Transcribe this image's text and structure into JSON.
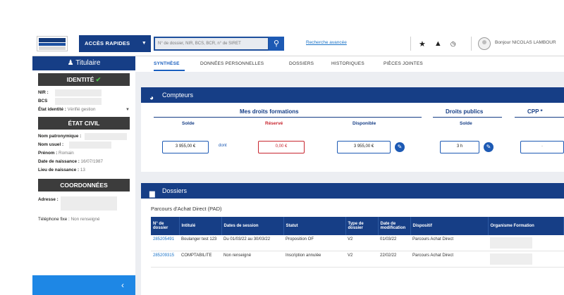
{
  "topbar": {
    "quick_access_label": "ACCÈS RAPIDES",
    "search_placeholder": "N° de dossier, NIR, BCS, BCR, n° de SIRET",
    "advanced_search_label": "Recherche avancée",
    "user_greeting": "Bonjour NICOLAS LAMBOUR",
    "icons": [
      "search-icon",
      "star-icon",
      "warning-icon",
      "clock-icon",
      "avatar-icon"
    ]
  },
  "sidebar": {
    "titulaire_label": "Titulaire",
    "identite": {
      "title": "IDENTITÉ",
      "nir_label": "NIR :",
      "bcs_label": "BCS",
      "etat_label": "État identité :",
      "etat_value": "Vérifié gestion"
    },
    "etat_civil": {
      "title": "ÉTAT CIVIL",
      "nom_patronymique": "Nom patronymique :",
      "nom_usuel": "Nom usuel :",
      "prenom_label": "Prénom :",
      "prenom_value": "Romain",
      "naissance_label": "Date de naissance :",
      "naissance_value": "16/07/1987",
      "lieu_label": "Lieu de naissance :",
      "lieu_value": "13"
    },
    "coordonnees": {
      "title": "COORDONNÉES",
      "adresse_label": "Adresse :",
      "tel_label": "Téléphone fixe :",
      "tel_value": "Non renseigné"
    },
    "collapse_label": "‹"
  },
  "tabs": [
    {
      "label": "SYNTHÈSE",
      "active": true
    },
    {
      "label": "DONNÉES PERSONNELLES",
      "active": false
    },
    {
      "label": "DOSSIERS",
      "active": false
    },
    {
      "label": "HISTORIQUES",
      "active": false
    },
    {
      "label": "PIÈCES JOINTES",
      "active": false
    }
  ],
  "compteurs": {
    "title": "Compteurs",
    "mes_droits": {
      "title": "Mes droits formations",
      "solde_label": "Solde",
      "solde_value": "3 955,00 €",
      "dont_label": "dont",
      "reserve_label": "Réservé",
      "reserve_value": "0,00 €",
      "disponible_label": "Disponible",
      "disponible_value": "3 955,00 €"
    },
    "droits_publics": {
      "title": "Droits publics",
      "solde_label": "Solde",
      "solde_value": "3 h"
    },
    "cpp": {
      "title": "CPP *",
      "value": "-"
    }
  },
  "dossiers": {
    "title": "Dossiers",
    "parcours_label": "Parcours d'Achat Direct (PAD)",
    "columns": [
      "N° de dossier",
      "Intitulé",
      "Dates de session",
      "Statut",
      "Type de dossier",
      "Date de modification",
      "Dispositif",
      "Organisme Formation"
    ],
    "rows": [
      {
        "num": "285205491",
        "intitule": "Boulanger test 123",
        "dates": "Du 01/03/22 au 30/03/22",
        "statut": "Proposition OF",
        "type": "V2",
        "modif": "01/03/22",
        "dispositif": "Parcours Achat Direct"
      },
      {
        "num": "285209315",
        "intitule": "COMPTABILITE",
        "dates": "Non renseigné",
        "statut": "Inscription annulée",
        "type": "V2",
        "modif": "22/02/22",
        "dispositif": "Parcours Achat Direct"
      }
    ]
  },
  "colors": {
    "navy": "#163e86",
    "accent_blue": "#1d5ab4",
    "reserve_red": "#c8262f",
    "collapse_blue": "#1e87e5",
    "check_green": "#4cc24c"
  }
}
